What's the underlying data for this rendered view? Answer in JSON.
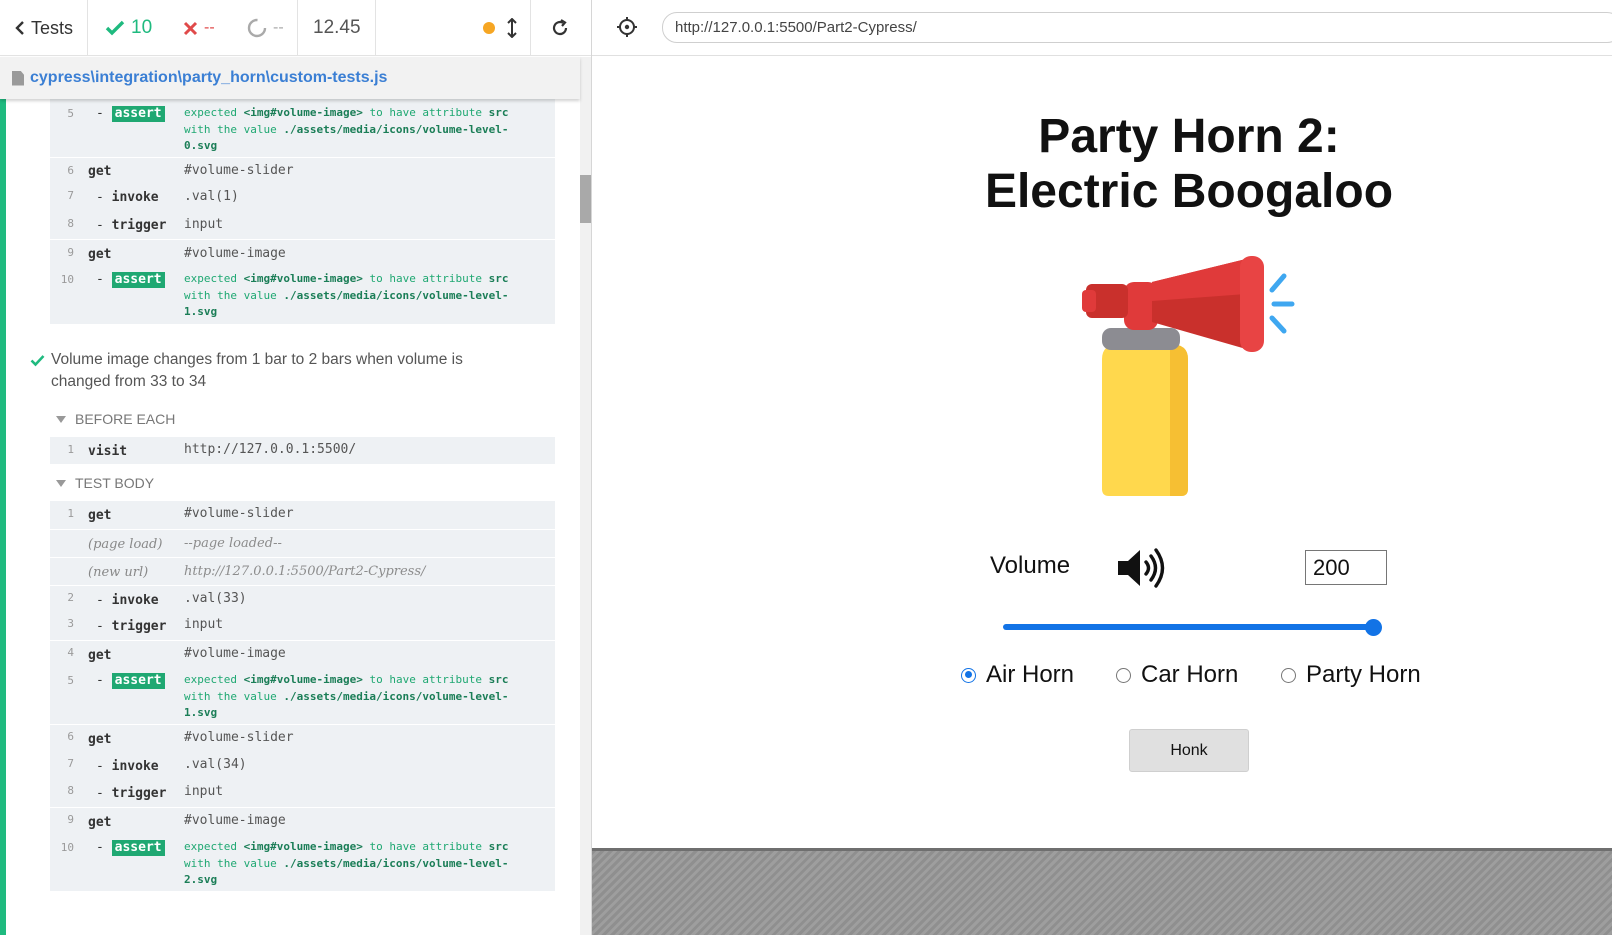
{
  "reporter": {
    "back_label": "Tests",
    "passed": "10",
    "failed": "--",
    "pending": "--",
    "duration": "12.45",
    "file_path": "cypress\\integration\\party_horn\\custom-tests.js",
    "status_color": "#1fba7f",
    "running_indicator_color": "#f6a623"
  },
  "top_group": {
    "rows": [
      {
        "num": "5",
        "name": "assert",
        "msg": "expected <img#volume-image> to have attribute src with the value ./assets/media/icons/volume-level-0.svg"
      },
      {
        "num": "6",
        "name": "get",
        "msg": "#volume-slider"
      },
      {
        "num": "7",
        "name": "invoke",
        "msg": ".val(1)"
      },
      {
        "num": "8",
        "name": "trigger",
        "msg": "input"
      },
      {
        "num": "9",
        "name": "get",
        "msg": "#volume-image"
      },
      {
        "num": "10",
        "name": "assert",
        "msg": "expected <img#volume-image> to have attribute src with the value ./assets/media/icons/volume-level-1.svg"
      }
    ],
    "assert_5": {
      "pre": "expected",
      "el": "<img#volume-image>",
      "mid": "to have attribute",
      "attr": "src",
      "line2": "with the value",
      "val1": "./assets/media/icons/volume-level-",
      "val2": "0.svg"
    },
    "assert_10": {
      "pre": "expected",
      "el": "<img#volume-image>",
      "mid": "to have attribute",
      "attr": "src",
      "line2": "with the value",
      "val1": "./assets/media/icons/volume-level-",
      "val2": "1.svg"
    }
  },
  "test": {
    "title": "Volume image changes from 1 bar to 2 bars when volume is changed from 33 to 34",
    "before_each_label": "BEFORE EACH",
    "test_body_label": "TEST BODY",
    "before_each_rows": [
      {
        "num": "1",
        "name": "visit",
        "msg": "http://127.0.0.1:5500/"
      }
    ],
    "body_rows": [
      {
        "num": "1",
        "name": "get",
        "msg": "#volume-slider"
      },
      {
        "num": "",
        "name": "(page load)",
        "msg": "--page loaded--"
      },
      {
        "num": "",
        "name": "(new url)",
        "msg": "http://127.0.0.1:5500/Part2-Cypress/"
      },
      {
        "num": "2",
        "name": "invoke",
        "msg": ".val(33)"
      },
      {
        "num": "3",
        "name": "trigger",
        "msg": "input"
      },
      {
        "num": "4",
        "name": "get",
        "msg": "#volume-image"
      },
      {
        "num": "5",
        "name": "assert",
        "msg": ""
      },
      {
        "num": "6",
        "name": "get",
        "msg": "#volume-slider"
      },
      {
        "num": "7",
        "name": "invoke",
        "msg": ".val(34)"
      },
      {
        "num": "8",
        "name": "trigger",
        "msg": "input"
      },
      {
        "num": "9",
        "name": "get",
        "msg": "#volume-image"
      },
      {
        "num": "10",
        "name": "assert",
        "msg": ""
      }
    ],
    "assert_b5": {
      "pre": "expected",
      "el": "<img#volume-image>",
      "mid": "to have attribute",
      "attr": "src",
      "line2": "with the value",
      "val1": "./assets/media/icons/volume-level-",
      "val2": "1.svg"
    },
    "assert_b10": {
      "pre": "expected",
      "el": "<img#volume-image>",
      "mid": "to have attribute",
      "attr": "src",
      "line2": "with the value",
      "val1": "./assets/media/icons/volume-level-",
      "val2": "2.svg"
    }
  },
  "aut": {
    "url": "http://127.0.0.1:5500/Part2-Cypress/",
    "heading_line1": "Party Horn 2:",
    "heading_line2": "Electric Boogaloo",
    "volume_label": "Volume",
    "volume_value": "200",
    "slider_fraction": 1.0,
    "slider_color": "#1273e6",
    "options": [
      "Air Horn",
      "Car Horn",
      "Party Horn"
    ],
    "selected_option": "Air Horn",
    "honk_label": "Honk"
  }
}
